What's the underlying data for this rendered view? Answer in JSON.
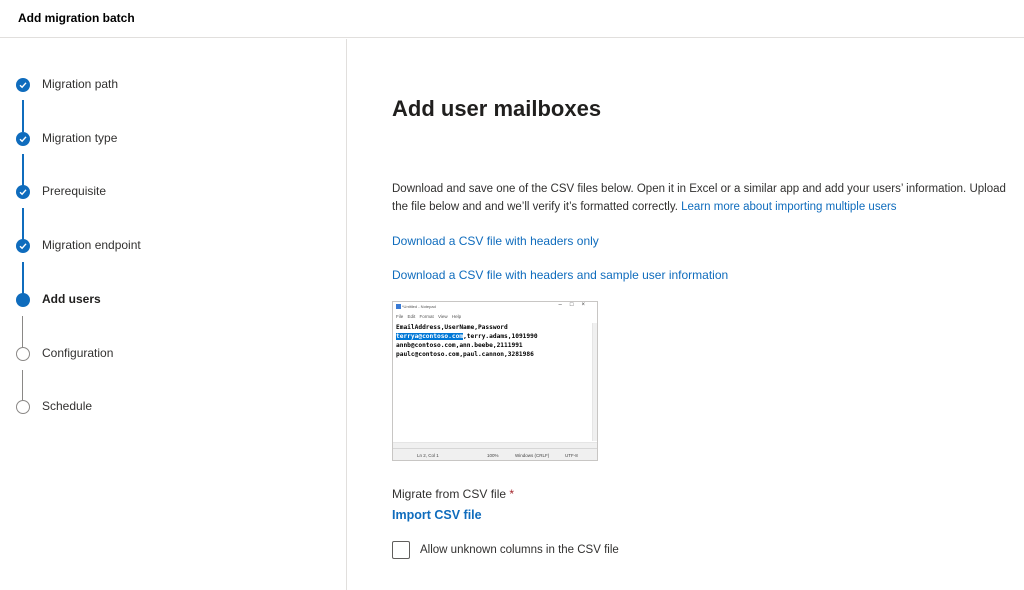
{
  "header": {
    "title": "Add migration batch"
  },
  "steps": [
    {
      "label": "Migration path",
      "state": "done"
    },
    {
      "label": "Migration type",
      "state": "done"
    },
    {
      "label": "Prerequisite",
      "state": "done"
    },
    {
      "label": "Migration endpoint",
      "state": "done"
    },
    {
      "label": "Add users",
      "state": "current"
    },
    {
      "label": "Configuration",
      "state": "pending"
    },
    {
      "label": "Schedule",
      "state": "pending"
    }
  ],
  "main": {
    "title": "Add user mailboxes",
    "description": "Download and save one of the CSV files below. Open it in Excel or a similar app and add your users’ information. Upload the file below and and we’ll verify it’s formatted correctly.",
    "learn_more": "Learn more about importing multiple users",
    "download_headers": "Download a CSV file with headers only",
    "download_sample": "Download a CSV file with headers and sample user information",
    "field_label": "Migrate from CSV file",
    "required_mark": "*",
    "import_label": "Import CSV file",
    "checkbox_label": "Allow unknown columns in the CSV file"
  },
  "notepad": {
    "title": "*Untitled - Notepad",
    "menu": "File Edit Format View Help",
    "line1": "EmailAddress,UserName,Password",
    "line2_selected": "terrya@contoso.com",
    "line2_rest": ",terry.adams,1091990",
    "line3": "annb@contoso.com,ann.beebe,2111991",
    "line4": "paulc@contoso.com,paul.cannon,3281986",
    "status_pos": "Ln 2, Col 1",
    "status_zoom": "100%",
    "status_eol": "Windows (CRLF)",
    "status_enc": "UTF-8"
  },
  "colors": {
    "accent": "#0f6cbd",
    "required": "#a4262c"
  }
}
